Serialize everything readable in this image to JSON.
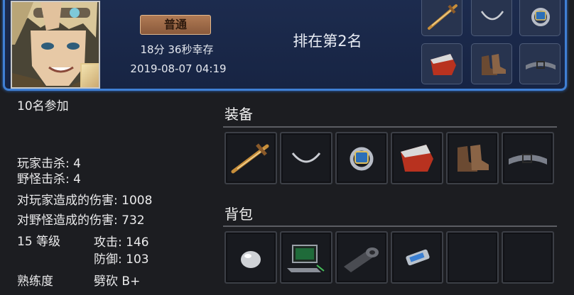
{
  "header": {
    "mode": "普通",
    "survival_time": "18分 36秒幸存",
    "datetime": "2019-08-07 04:19",
    "rank": "排在第2名",
    "top_items": [
      "sword-icon",
      "necklace-icon",
      "ring-icon",
      "armor-icon",
      "boots-icon",
      "belt-icon"
    ]
  },
  "stats": {
    "participants": "10名参加",
    "player_kills": "玩家击杀: 4",
    "monster_kills": "野怪击杀: 4",
    "damage_to_players": "对玩家造成的伤害: 1008",
    "damage_to_monsters": "对野怪造成的伤害: 732",
    "level": "15 等级",
    "attack": "攻击: 146",
    "defense": "防御: 103",
    "proficiency_label": "熟练度",
    "proficiency_value": "劈砍 B+"
  },
  "equipment": {
    "title": "装备",
    "items": [
      "sword-icon",
      "necklace-icon",
      "ring-icon",
      "armor-icon",
      "boots-icon",
      "belt-icon"
    ]
  },
  "backpack": {
    "title": "背包",
    "items": [
      "orb-icon",
      "laptop-icon",
      "tape-roll-icon",
      "device-icon",
      "",
      ""
    ]
  }
}
